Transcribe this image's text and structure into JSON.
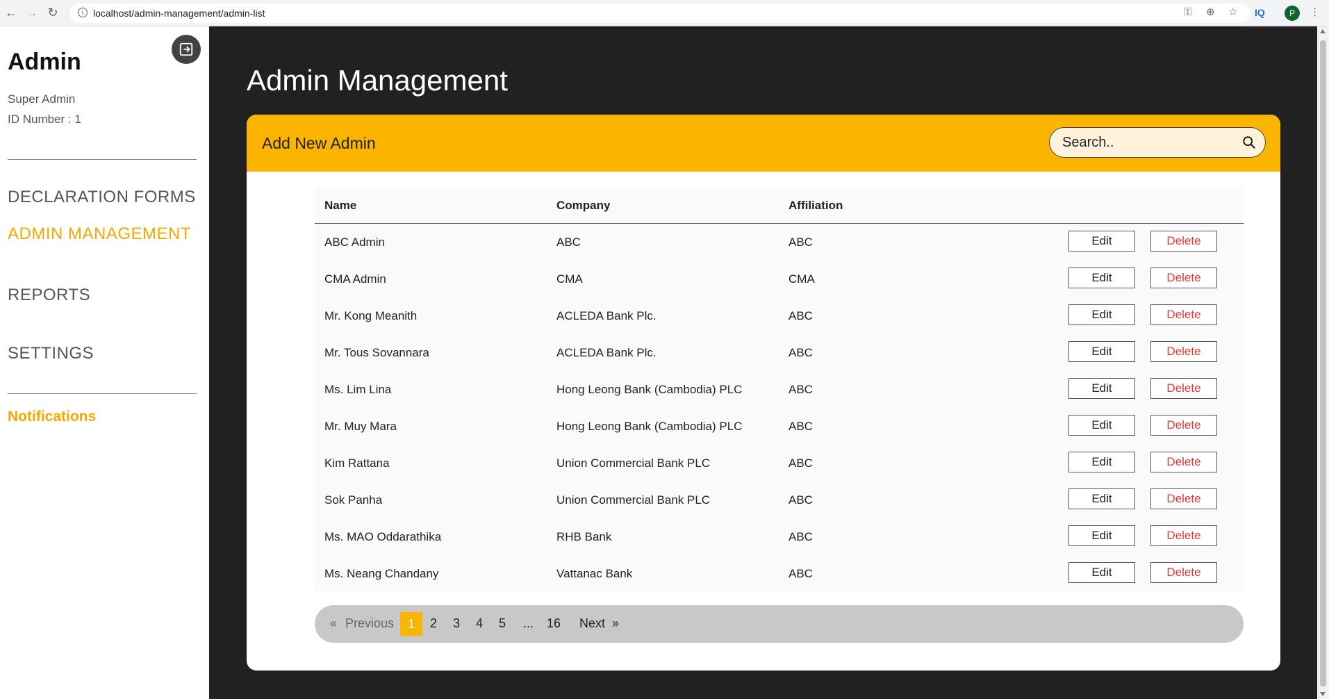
{
  "browser": {
    "url": "localhost/admin-management/admin-list",
    "profile_initial": "P",
    "extension_label": "IQ"
  },
  "sidebar": {
    "title": "Admin",
    "role": "Super Admin",
    "id_text": "ID Number : 1",
    "nav": [
      {
        "label": "DECLARATION FORMS",
        "active": false
      },
      {
        "label": "ADMIN MANAGEMENT",
        "active": true
      },
      {
        "label": "REPORTS",
        "active": false
      },
      {
        "label": "SETTINGS",
        "active": false
      }
    ],
    "notifications": "Notifications"
  },
  "main": {
    "title": "Admin Management",
    "add_button": "Add New Admin",
    "search_placeholder": "Search..",
    "columns": [
      "Name",
      "Company",
      "Affiliation"
    ],
    "edit_label": "Edit",
    "delete_label": "Delete",
    "rows": [
      {
        "name": "ABC Admin",
        "company": "ABC",
        "affiliation": "ABC"
      },
      {
        "name": "CMA Admin",
        "company": "CMA",
        "affiliation": "CMA"
      },
      {
        "name": "Mr. Kong Meanith",
        "company": "ACLEDA Bank Plc.",
        "affiliation": "ABC"
      },
      {
        "name": "Mr. Tous Sovannara",
        "company": "ACLEDA Bank Plc.",
        "affiliation": "ABC"
      },
      {
        "name": "Ms. Lim Lina",
        "company": "Hong Leong Bank (Cambodia) PLC",
        "affiliation": "ABC"
      },
      {
        "name": "Mr. Muy Mara",
        "company": "Hong Leong Bank (Cambodia) PLC",
        "affiliation": "ABC"
      },
      {
        "name": "Kim Rattana",
        "company": "Union Commercial Bank PLC",
        "affiliation": "ABC"
      },
      {
        "name": "Sok Panha",
        "company": "Union Commercial Bank PLC",
        "affiliation": "ABC"
      },
      {
        "name": "Ms. MAO Oddarathika",
        "company": "RHB Bank",
        "affiliation": "ABC"
      },
      {
        "name": "Ms. Neang Chandany",
        "company": "Vattanac Bank",
        "affiliation": "ABC"
      }
    ],
    "pagination": {
      "first": "«",
      "previous": "Previous",
      "pages": [
        "1",
        "2",
        "3",
        "4",
        "5",
        "...",
        "16"
      ],
      "current": "1",
      "next": "Next",
      "last": "»"
    }
  },
  "colors": {
    "accent": "#fbb400",
    "dark_bg": "#212121",
    "delete": "#e53935"
  }
}
